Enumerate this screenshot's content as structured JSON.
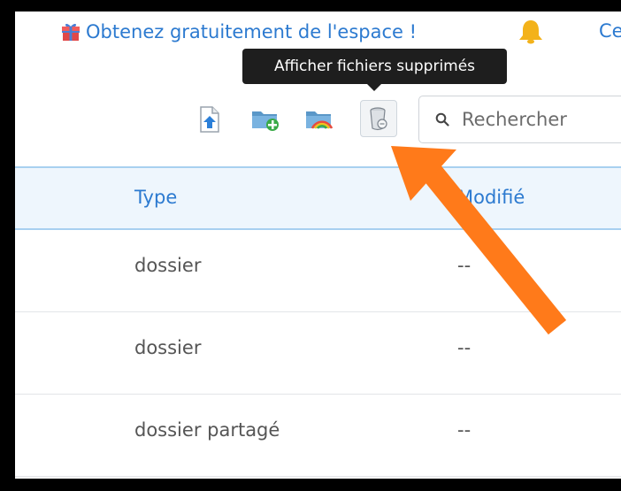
{
  "promo": {
    "text": "Obtenez gratuitement de l'espace !",
    "next_link": "Ce"
  },
  "tooltip": {
    "text": "Afficher fichiers supprimés"
  },
  "toolbar": {
    "icons": [
      "upload-file-icon",
      "new-folder-icon",
      "gallery-folder-icon",
      "trash-icon"
    ]
  },
  "search": {
    "placeholder": "Rechercher"
  },
  "table": {
    "columns": [
      "Type",
      "Modifié"
    ],
    "rows": [
      {
        "type": "dossier",
        "modified": "--"
      },
      {
        "type": "dossier",
        "modified": "--"
      },
      {
        "type": "dossier partagé",
        "modified": "--"
      }
    ]
  },
  "colors": {
    "link": "#2c7ad0",
    "header_bg": "#eef6fd",
    "annotation_arrow": "#ff7a1a",
    "tooltip_bg": "#1e1e1e"
  }
}
